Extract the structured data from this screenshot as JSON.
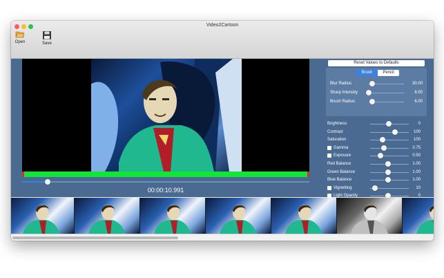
{
  "window": {
    "title": "Video2Cartoon",
    "controls": {
      "close_color": "#fc5f57",
      "minimize_color": "#fdbc2e",
      "zoom_color": "#2ac840"
    }
  },
  "toolbar": {
    "open_label": "Open",
    "save_label": "Save"
  },
  "player": {
    "timecode": "00:00:10.991",
    "progress_color": "#12e43a",
    "scrub_position": 0.09
  },
  "panel": {
    "reset_label": "Reset Values to Defaults",
    "brush_tabs": [
      {
        "label": "Brush",
        "selected": true
      },
      {
        "label": "Pencil",
        "selected": false
      }
    ],
    "brush_settings": [
      {
        "label": "Blur Radius",
        "value": "30.00",
        "level": 0.1
      },
      {
        "label": "Sharp Intensity",
        "value": "8.00",
        "level": 0.0
      },
      {
        "label": "Brush Radius",
        "value": "6.00",
        "level": 0.1
      }
    ],
    "adjustments": [
      {
        "label": "Brightness",
        "value": "0",
        "checkbox": false,
        "level": 0.48
      },
      {
        "label": "Contrast",
        "value": "100",
        "checkbox": false,
        "level": 0.65
      },
      {
        "label": "Saturation",
        "value": "100",
        "checkbox": false,
        "level": 0.32
      },
      {
        "label": "Gamma",
        "value": "0.75",
        "checkbox": true,
        "level": 0.36
      },
      {
        "label": "Exposure",
        "value": "0.50",
        "checkbox": true,
        "level": 0.26
      },
      {
        "label": "Red Balance",
        "value": "1.00",
        "checkbox": false,
        "level": 0.46
      },
      {
        "label": "Green Balance",
        "value": "1.00",
        "checkbox": false,
        "level": 0.46
      },
      {
        "label": "Blue Balance",
        "value": "1.00",
        "checkbox": false,
        "level": 0.46
      },
      {
        "label": "Vignetting",
        "value": "10",
        "checkbox": true,
        "level": 0.12
      },
      {
        "label": "Light Opacity",
        "value": "0",
        "checkbox": true,
        "level": 0.46
      }
    ]
  },
  "filmstrip": {
    "frames": [
      {
        "style": "color"
      },
      {
        "style": "color"
      },
      {
        "style": "color"
      },
      {
        "style": "color"
      },
      {
        "style": "color"
      },
      {
        "style": "gray"
      },
      {
        "style": "color"
      }
    ]
  }
}
